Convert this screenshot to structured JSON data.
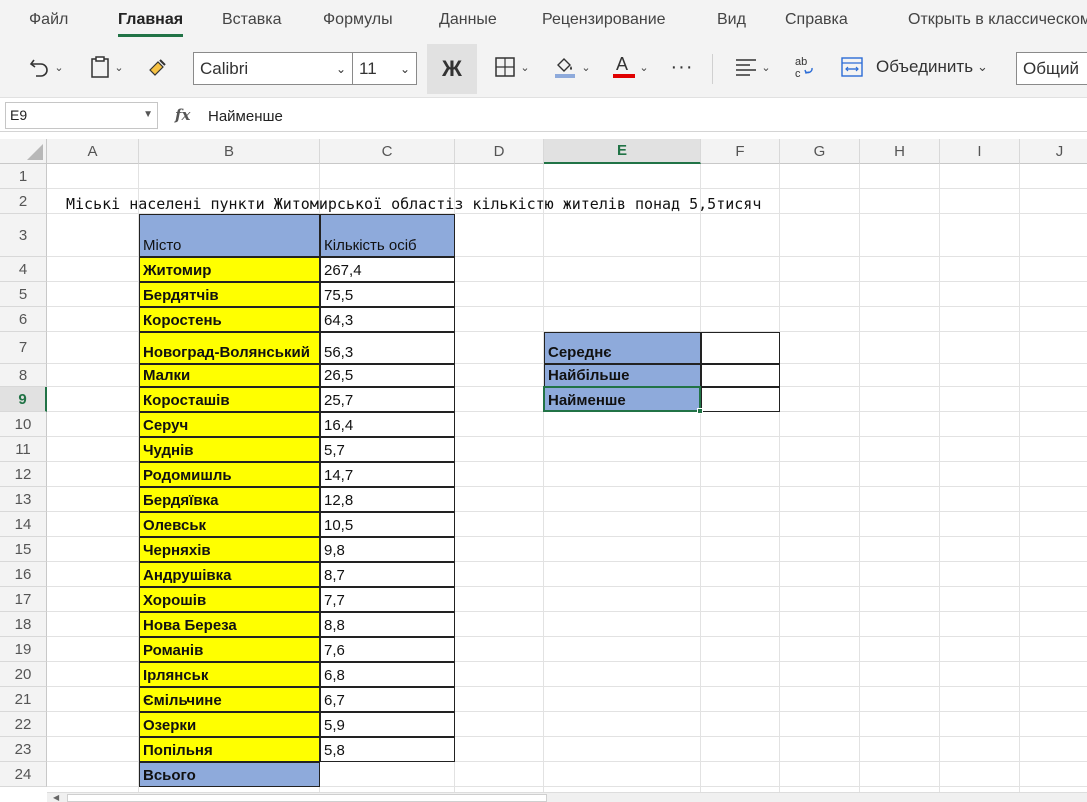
{
  "menu": {
    "items": [
      "Файл",
      "Главная",
      "Вставка",
      "Формулы",
      "Данные",
      "Рецензирование",
      "Вид",
      "Справка",
      "Открыть в классическом"
    ],
    "active_index": 1
  },
  "toolbar": {
    "font_name": "Calibri",
    "font_size": "11",
    "bold_label": "Ж",
    "more_label": "···",
    "merge_label": "Объединить",
    "number_format": "Общий"
  },
  "formula_bar": {
    "name_box": "E9",
    "fx_label": "fx",
    "formula": "Найменше"
  },
  "columns": [
    "A",
    "B",
    "C",
    "D",
    "E",
    "F",
    "G",
    "H",
    "I",
    "J"
  ],
  "selected_column": "E",
  "rows": [
    "1",
    "2",
    "3",
    "4",
    "5",
    "6",
    "7",
    "8",
    "9",
    "10",
    "11",
    "12",
    "13",
    "14",
    "15",
    "16",
    "17",
    "18",
    "19",
    "20",
    "21",
    "22",
    "23",
    "24"
  ],
  "selected_row": "9",
  "sheet": {
    "title": "Міські населені пункти Житомирської областіз кількістю жителів понад 5,5тисяч",
    "table_headers": {
      "city": "Місто",
      "population": "Кількість осіб"
    },
    "cities": [
      {
        "city": "Житомир",
        "population": "267,4"
      },
      {
        "city": "Бердятчів",
        "population": "75,5"
      },
      {
        "city": "Коростень",
        "population": "64,3"
      },
      {
        "city": "Новоград-Волянський",
        "population": "56,3"
      },
      {
        "city": "Малки",
        "population": "26,5"
      },
      {
        "city": "Короcташів",
        "population": "25,7"
      },
      {
        "city": "Серуч",
        "population": "16,4"
      },
      {
        "city": "Чуднів",
        "population": "5,7"
      },
      {
        "city": "Родомишль",
        "population": "14,7"
      },
      {
        "city": "Бердяївка",
        "population": "12,8"
      },
      {
        "city": "Олевськ",
        "population": "10,5"
      },
      {
        "city": "Черняхів",
        "population": "9,8"
      },
      {
        "city": "Андрушівка",
        "population": "8,7"
      },
      {
        "city": "Хорошів",
        "population": "7,7"
      },
      {
        "city": "Нова Береза",
        "population": "8,8"
      },
      {
        "city": "Романів",
        "population": "7,6"
      },
      {
        "city": "Ірлянськ",
        "population": "6,8"
      },
      {
        "city": "Ємільчине",
        "population": "6,7"
      },
      {
        "city": "Озерки",
        "population": "5,9"
      },
      {
        "city": "Попільня",
        "population": "5,8"
      }
    ],
    "total_label": "Всього",
    "stats": [
      "Середнє",
      "Найбільше",
      "Найменше"
    ]
  },
  "colors": {
    "accent": "#217346",
    "city_fill": "#ffff00",
    "header_fill": "#8eaadb"
  }
}
